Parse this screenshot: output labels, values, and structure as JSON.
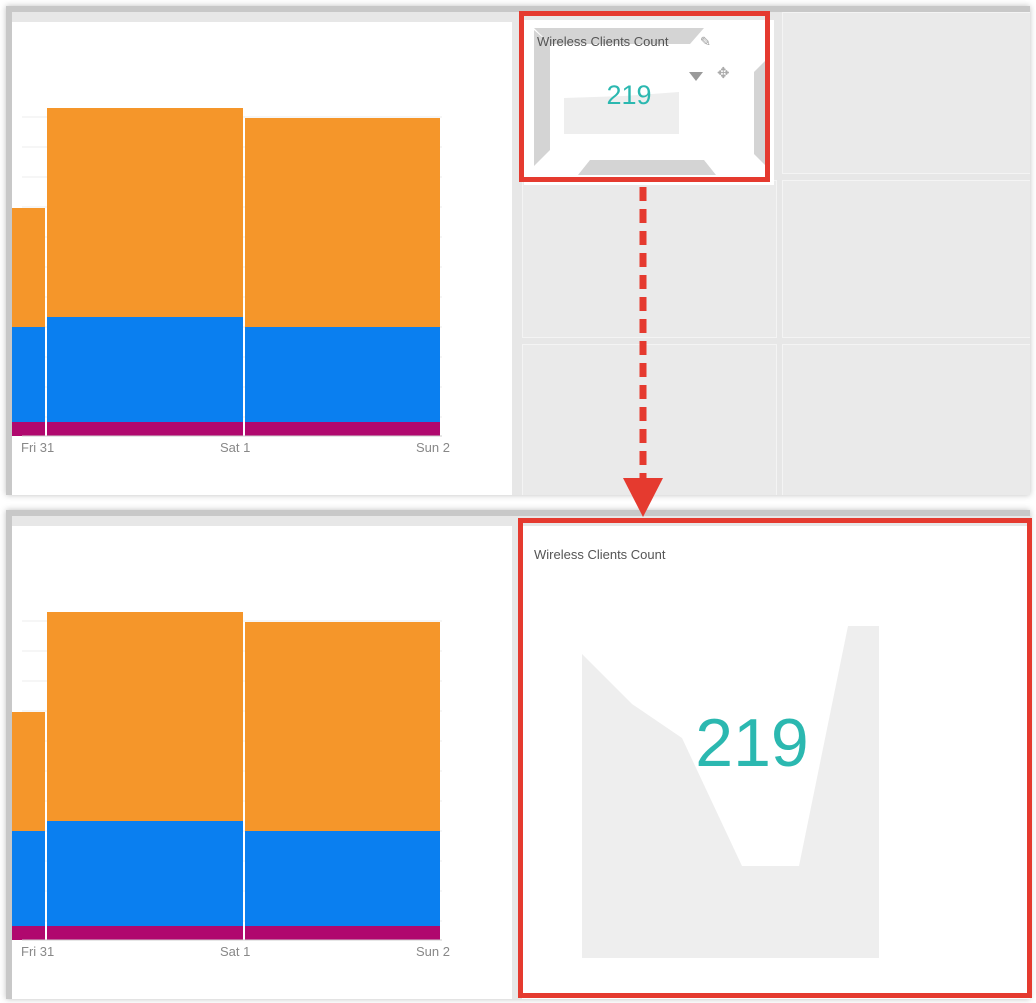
{
  "top_panel": {
    "chart": {
      "x_ticks": [
        "Fri 31",
        "Sat 1",
        "Sun 2"
      ],
      "colors": {
        "orange": "#f5962a",
        "blue": "#0a7ff0",
        "purple": "#b0086e"
      }
    },
    "widget": {
      "title": "Wireless Clients Count",
      "value": "219",
      "icons": [
        "pencil-icon",
        "dropdown-triangle-icon",
        "move-icon"
      ]
    }
  },
  "bottom_panel": {
    "chart": {
      "x_ticks": [
        "Fri 31",
        "Sat 1",
        "Sun 2"
      ]
    },
    "widget": {
      "title": "Wireless Clients Count",
      "value": "219"
    }
  },
  "annotation": {
    "highlight_color": "#e53a2f"
  }
}
